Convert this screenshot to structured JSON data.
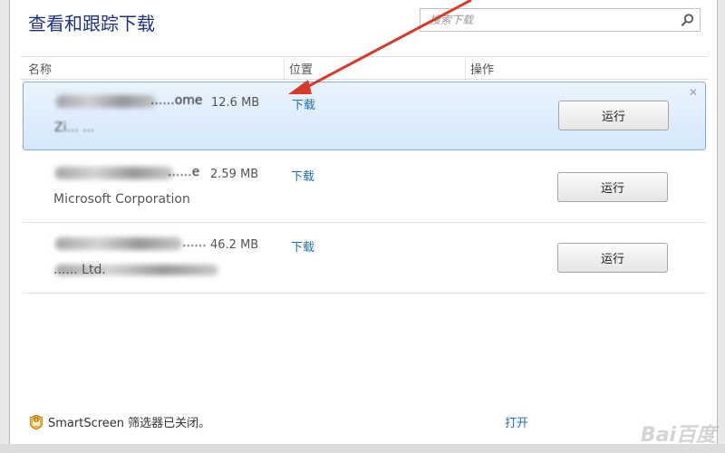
{
  "window": {
    "title": "查看和跟踪下载",
    "search_placeholder": "搜索下载"
  },
  "columns": {
    "name": "名称",
    "location": "位置",
    "action": "操作"
  },
  "downloads": [
    {
      "filename": "......ome",
      "publisher": "Zi... ...",
      "size": "12.6 MB",
      "location": "下载",
      "action": "运行",
      "selected": true
    },
    {
      "filename": "......e",
      "publisher": "Microsoft Corporation",
      "size": "2.59 MB",
      "location": "下载",
      "action": "运行",
      "selected": false
    },
    {
      "filename": "......",
      "publisher": "...... Ltd.",
      "size": "46.2 MB",
      "location": "下载",
      "action": "运行",
      "selected": false
    }
  ],
  "footer": {
    "smartscreen": "SmartScreen 筛选器已关闭。",
    "open_link": "打开"
  },
  "colors": {
    "title": "#1e3287",
    "link": "#1e6fb8",
    "arrow": "#d73a2b",
    "selection": "#d5e8fb"
  }
}
